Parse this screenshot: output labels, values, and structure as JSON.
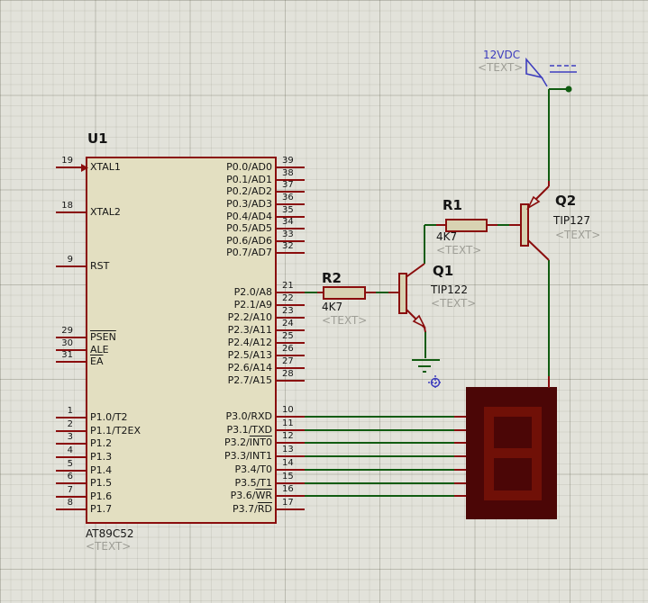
{
  "app": {
    "name": "schematic-canvas"
  },
  "colors": {
    "background": "#e2e2da",
    "pin_red": "#8a0d0d",
    "wire_green": "#115c11",
    "chip_fill": "#e3dfc1",
    "component_fill": "#d8d2b2",
    "display_body": "#4b0606",
    "display_segment": "#701007",
    "power_blue": "#3d3dbe",
    "placeholder_gray": "#9e9e96"
  },
  "chip": {
    "refdes": "U1",
    "part": "AT89C52",
    "placeholder": "<TEXT>",
    "left_groups": [
      {
        "pins": [
          {
            "num": "19",
            "pre": "XTAL1"
          },
          {
            "num": "18",
            "pre": "XTAL2"
          },
          {
            "num": "9",
            "pre": "RST"
          }
        ]
      },
      {
        "pins": [
          {
            "num": "29",
            "pre": "",
            "bar": "PSEN"
          },
          {
            "num": "30",
            "pre": "ALE"
          },
          {
            "num": "31",
            "pre": "",
            "bar": "EA"
          }
        ]
      },
      {
        "pins": [
          {
            "num": "1",
            "pre": "P1.0/T2"
          },
          {
            "num": "2",
            "pre": "P1.1/T2EX"
          },
          {
            "num": "3",
            "pre": "P1.2"
          },
          {
            "num": "4",
            "pre": "P1.3"
          },
          {
            "num": "5",
            "pre": "P1.4"
          },
          {
            "num": "6",
            "pre": "P1.5"
          },
          {
            "num": "7",
            "pre": "P1.6"
          },
          {
            "num": "8",
            "pre": "P1.7"
          }
        ]
      }
    ],
    "right_groups": [
      {
        "pins": [
          {
            "num": "39",
            "pre": "P0.0/AD0"
          },
          {
            "num": "38",
            "pre": "P0.1/AD1"
          },
          {
            "num": "37",
            "pre": "P0.2/AD2"
          },
          {
            "num": "36",
            "pre": "P0.3/AD3"
          },
          {
            "num": "35",
            "pre": "P0.4/AD4"
          },
          {
            "num": "34",
            "pre": "P0.5/AD5"
          },
          {
            "num": "33",
            "pre": "P0.6/AD6"
          },
          {
            "num": "32",
            "pre": "P0.7/AD7"
          }
        ]
      },
      {
        "pins": [
          {
            "num": "21",
            "pre": "P2.0/A8"
          },
          {
            "num": "22",
            "pre": "P2.1/A9"
          },
          {
            "num": "23",
            "pre": "P2.2/A10"
          },
          {
            "num": "24",
            "pre": "P2.3/A11"
          },
          {
            "num": "25",
            "pre": "P2.4/A12"
          },
          {
            "num": "26",
            "pre": "P2.5/A13"
          },
          {
            "num": "27",
            "pre": "P2.6/A14"
          },
          {
            "num": "28",
            "pre": "P2.7/A15"
          }
        ]
      },
      {
        "pins": [
          {
            "num": "10",
            "pre": "P3.0/RXD"
          },
          {
            "num": "11",
            "pre": "P3.1/TXD"
          },
          {
            "num": "12",
            "pre": "P3.2/",
            "bar": "INT0"
          },
          {
            "num": "13",
            "pre": "P3.3/INT1"
          },
          {
            "num": "14",
            "pre": "P3.4/T0"
          },
          {
            "num": "15",
            "pre": "P3.5/T1"
          },
          {
            "num": "16",
            "pre": "P3.6/",
            "bar": "WR"
          },
          {
            "num": "17",
            "pre": "P3.7/",
            "bar": "RD"
          }
        ]
      }
    ]
  },
  "parts": {
    "u1": {
      "refdes": "U1",
      "value": "AT89C52",
      "placeholder": "<TEXT>"
    },
    "r1": {
      "refdes": "R1",
      "value": "4K7",
      "placeholder": "<TEXT>"
    },
    "r2": {
      "refdes": "R2",
      "value": "4K7",
      "placeholder": "<TEXT>"
    },
    "q1": {
      "refdes": "Q1",
      "value": "TIP122",
      "placeholder": "<TEXT>"
    },
    "q2": {
      "refdes": "Q2",
      "value": "TIP127",
      "placeholder": "<TEXT>"
    },
    "power": {
      "label": "12VDC",
      "placeholder": "<TEXT>"
    }
  }
}
